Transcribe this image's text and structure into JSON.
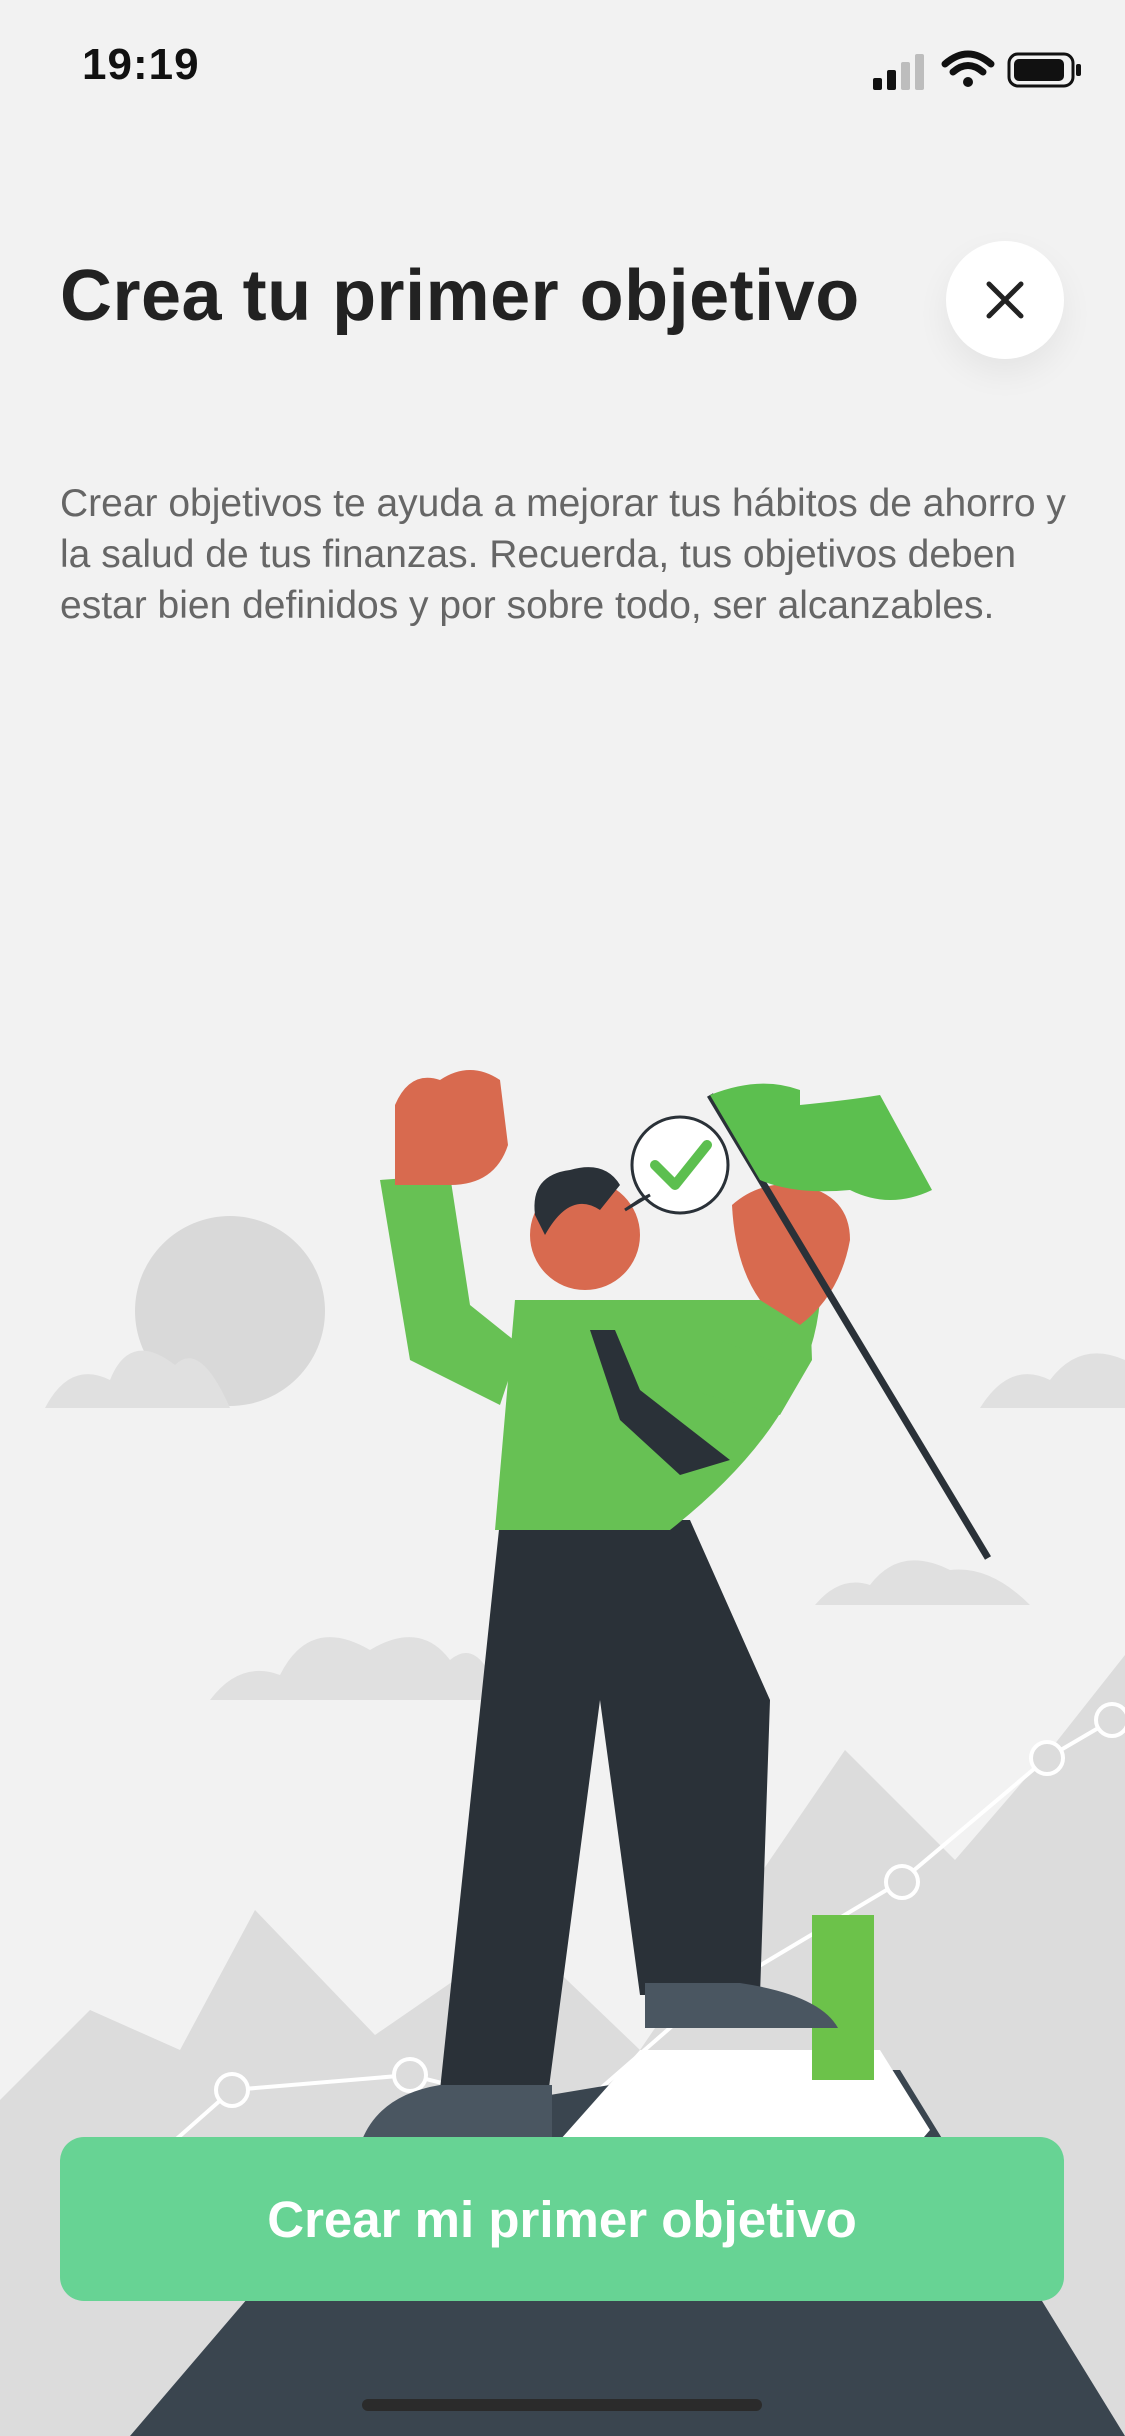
{
  "status_bar": {
    "time": "19:19",
    "icons": [
      "signal-icon",
      "wifi-icon",
      "battery-icon"
    ]
  },
  "header": {
    "title": "Crea tu primer objetivo",
    "close_icon": "close-icon"
  },
  "description": "Crear objetivos te ayuda a mejorar tus hábitos de ahorro y la salud de tus finanzas. Recuerda, tus objetivos deben estar bien definidos y por sobre todo, ser alcanzables.",
  "cta": {
    "label": "Crear mi primer objetivo"
  },
  "illustration": {
    "icon": "goal-achieved-illustration"
  },
  "colors": {
    "background": "#f2f2f2",
    "primary_button": "#67d394",
    "title_text": "#222222",
    "body_text": "#666666",
    "accent_green": "#5cbf4f"
  }
}
